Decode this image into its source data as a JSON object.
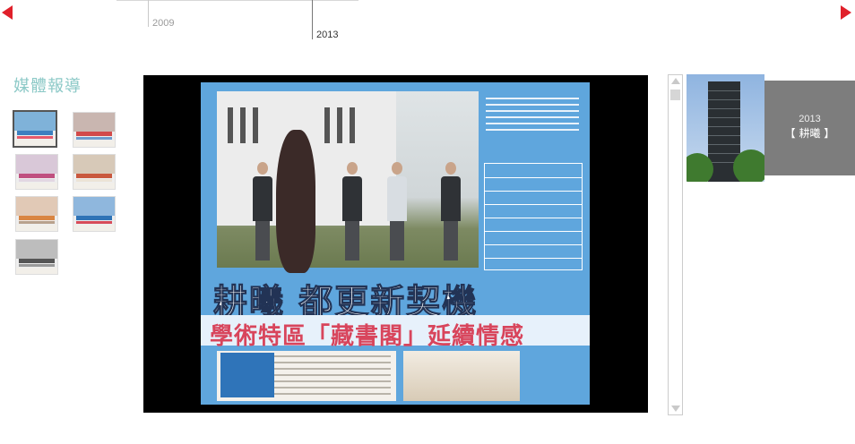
{
  "timeline": {
    "years": [
      {
        "label": "2009",
        "active": false
      },
      {
        "label": "2013",
        "active": true
      }
    ]
  },
  "section": {
    "title": "媒體報導"
  },
  "thumbnails": {
    "count": 7,
    "selected_index": 0
  },
  "viewer": {
    "article": {
      "headline": "耕曦 都更新契機",
      "subhead": "學術特區「藏書閣」延續情感"
    }
  },
  "project": {
    "year": "2013",
    "name": "【 耕曦 】"
  },
  "colors": {
    "accent_red": "#e0202a",
    "section_title": "#8cc9c7",
    "project_card": "#7d7d7d"
  },
  "icons": {
    "prev": "triangle-left-icon",
    "next": "triangle-right-icon",
    "scroll_up": "scroll-up-arrow-icon",
    "scroll_down": "scroll-down-arrow-icon"
  }
}
